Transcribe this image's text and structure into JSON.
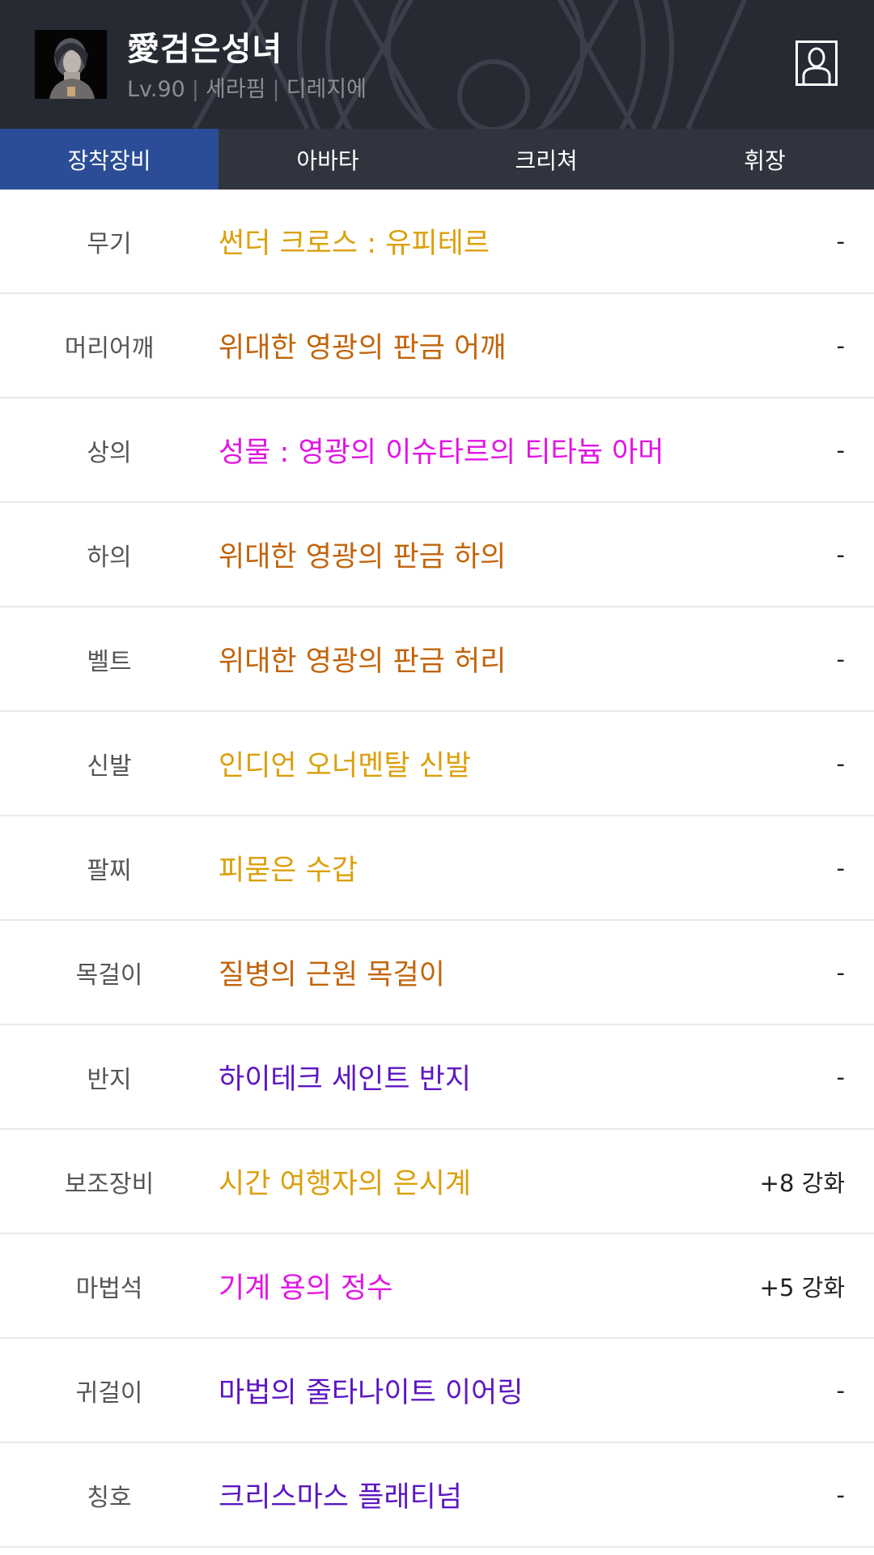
{
  "header": {
    "name": "愛검은성녀",
    "level": "Lv.90",
    "job": "세라핌",
    "server": "디레지에",
    "separator": "|",
    "avatar_icon": "character-portrait-icon",
    "profile_icon": "user-profile-icon"
  },
  "tabs": [
    {
      "label": "장착장비",
      "active": true
    },
    {
      "label": "아바타",
      "active": false
    },
    {
      "label": "크리쳐",
      "active": false
    },
    {
      "label": "휘장",
      "active": false
    }
  ],
  "colors": {
    "header_bg": "#262a33",
    "tab_bar_bg": "#30343e",
    "tab_active_bg": "#2b4c96",
    "rarity_epic": "#dba00b",
    "rarity_legendary": "#c2640b",
    "rarity_set": "#e214e3",
    "rarity_unique": "#5c16c3"
  },
  "equipment": [
    {
      "slot": "무기",
      "item": "썬더 크로스 : 유피테르",
      "enhancement": "-",
      "color": "#dba00b"
    },
    {
      "slot": "머리어깨",
      "item": "위대한 영광의 판금 어깨",
      "enhancement": "-",
      "color": "#c2640b"
    },
    {
      "slot": "상의",
      "item": "성물 : 영광의 이슈타르의 티타늄 아머",
      "enhancement": "-",
      "color": "#e214e3"
    },
    {
      "slot": "하의",
      "item": "위대한 영광의 판금 하의",
      "enhancement": "-",
      "color": "#c2640b"
    },
    {
      "slot": "벨트",
      "item": "위대한 영광의 판금 허리",
      "enhancement": "-",
      "color": "#c2640b"
    },
    {
      "slot": "신발",
      "item": "인디언 오너멘탈 신발",
      "enhancement": "-",
      "color": "#dba00b"
    },
    {
      "slot": "팔찌",
      "item": "피묻은 수갑",
      "enhancement": "-",
      "color": "#dba00b"
    },
    {
      "slot": "목걸이",
      "item": "질병의 근원 목걸이",
      "enhancement": "-",
      "color": "#c2640b"
    },
    {
      "slot": "반지",
      "item": "하이테크 세인트 반지",
      "enhancement": "-",
      "color": "#5c16c3"
    },
    {
      "slot": "보조장비",
      "item": "시간 여행자의 은시계",
      "enhancement": "+8 강화",
      "color": "#dba00b"
    },
    {
      "slot": "마법석",
      "item": "기계 용의 정수",
      "enhancement": "+5 강화",
      "color": "#e214e3"
    },
    {
      "slot": "귀걸이",
      "item": "마법의 줄타나이트 이어링",
      "enhancement": "-",
      "color": "#5c16c3"
    },
    {
      "slot": "칭호",
      "item": "크리스마스 플래티넘",
      "enhancement": "-",
      "color": "#5c16c3"
    }
  ]
}
